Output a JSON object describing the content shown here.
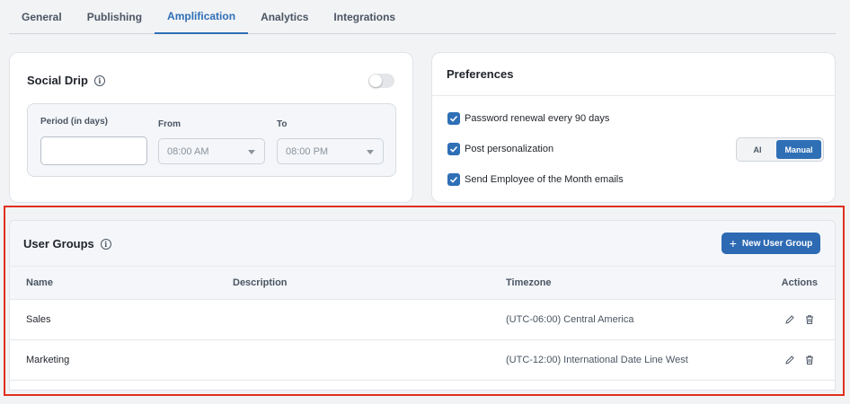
{
  "tabs": [
    {
      "label": "General"
    },
    {
      "label": "Publishing"
    },
    {
      "label": "Amplification",
      "active": true
    },
    {
      "label": "Analytics"
    },
    {
      "label": "Integrations"
    }
  ],
  "social_drip": {
    "title": "Social Drip",
    "enabled": false,
    "period_label": "Period (in days)",
    "period_value": "",
    "from_label": "From",
    "from_value": "08:00 AM",
    "to_label": "To",
    "to_value": "08:00 PM"
  },
  "preferences": {
    "title": "Preferences",
    "items": [
      {
        "label": "Password renewal every 90 days",
        "checked": true
      },
      {
        "label": "Post personalization",
        "checked": true
      },
      {
        "label": "Send Employee of the Month emails",
        "checked": true
      }
    ],
    "personalization_mode": {
      "options": [
        "AI",
        "Manual"
      ],
      "selected": "Manual"
    }
  },
  "user_groups": {
    "title": "User Groups",
    "new_button_label": "New User Group",
    "columns": [
      "Name",
      "Description",
      "Timezone",
      "Actions"
    ],
    "rows": [
      {
        "name": "Sales",
        "description": "",
        "timezone": "(UTC-06:00) Central America"
      },
      {
        "name": "Marketing",
        "description": "",
        "timezone": "(UTC-12:00) International Date Line West"
      }
    ]
  },
  "colors": {
    "accent": "#2f6fb6",
    "highlight": "#e0301e"
  }
}
